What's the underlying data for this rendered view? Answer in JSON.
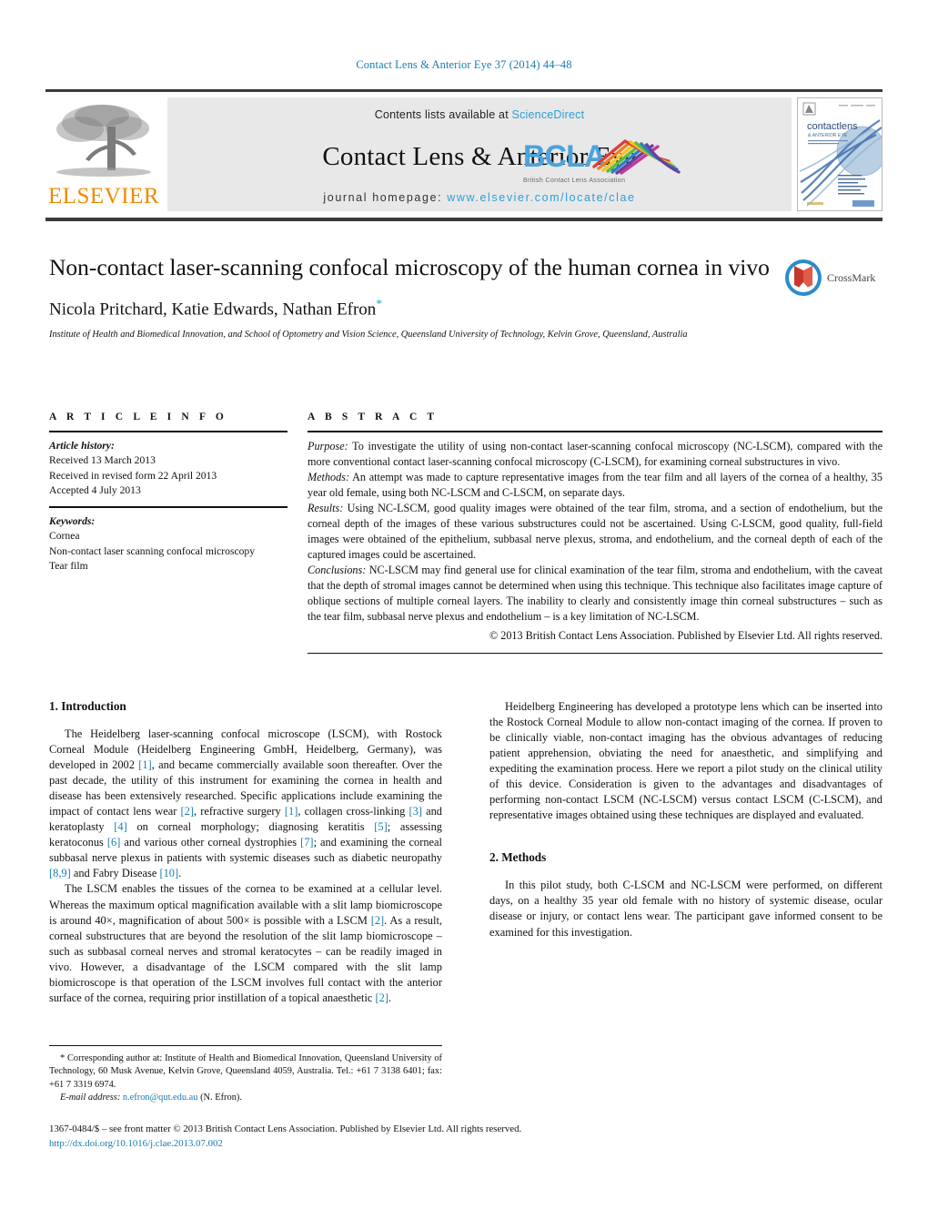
{
  "running_head": "Contact Lens & Anterior Eye 37 (2014) 44–48",
  "masthead": {
    "contents_prefix": "Contents lists available at ",
    "sciencedirect": "ScienceDirect",
    "journal_title": "Contact Lens & Anterior Eye",
    "homepage_prefix": "journal homepage: ",
    "homepage_url": "www.elsevier.com/locate/clae",
    "publisher_wordmark": "ELSEVIER",
    "society_acronym": "BCLA",
    "society_name": "British Contact Lens Association",
    "cover_title": "contactlens",
    "cover_subtitle": "& ANTERIOR EYE",
    "colors": {
      "link": "#2a9fd6",
      "elsevier_orange": "#f08a00",
      "panel_grey": "#e8e8e8",
      "rule_dark": "#3b3b3b",
      "bcla_blue": "#4aa3dd"
    }
  },
  "article": {
    "title": "Non-contact laser-scanning confocal microscopy of the human cornea in vivo",
    "authors": "Nicola Pritchard, Katie Edwards, Nathan Efron",
    "corresponding_marker": "*",
    "affiliation": "Institute of Health and Biomedical Innovation, and School of Optometry and Vision Science, Queensland University of Technology, Kelvin Grove, Queensland, Australia",
    "crossmark_label": "CrossMark"
  },
  "article_info": {
    "heading": "A R T I C L E   I N F O",
    "history_label": "Article history:",
    "history": [
      "Received 13 March 2013",
      "Received in revised form 22 April 2013",
      "Accepted 4 July 2013"
    ],
    "keywords_label": "Keywords:",
    "keywords": [
      "Cornea",
      "Non-contact laser scanning confocal microscopy",
      "Tear film"
    ]
  },
  "abstract": {
    "heading": "A B S T R A C T",
    "purpose_label": "Purpose:",
    "purpose_text": " To investigate the utility of using non-contact laser-scanning confocal microscopy (NC-LSCM), compared with the more conventional contact laser-scanning confocal microscopy (C-LSCM), for examining corneal substructures in vivo.",
    "methods_label": "Methods:",
    "methods_text": " An attempt was made to capture representative images from the tear film and all layers of the cornea of a healthy, 35 year old female, using both NC-LSCM and C-LSCM, on separate days.",
    "results_label": "Results:",
    "results_text": " Using NC-LSCM, good quality images were obtained of the tear film, stroma, and a section of endothelium, but the corneal depth of the images of these various substructures could not be ascertained. Using C-LSCM, good quality, full-field images were obtained of the epithelium, subbasal nerve plexus, stroma, and endothelium, and the corneal depth of each of the captured images could be ascertained.",
    "conclusions_label": "Conclusions:",
    "conclusions_text": " NC-LSCM may find general use for clinical examination of the tear film, stroma and endothelium, with the caveat that the depth of stromal images cannot be determined when using this technique. This technique also facilitates image capture of oblique sections of multiple corneal layers. The inability to clearly and consistently image thin corneal substructures – such as the tear film, subbasal nerve plexus and endothelium – is a key limitation of NC-LSCM.",
    "copyright": "© 2013 British Contact Lens Association. Published by Elsevier Ltd. All rights reserved."
  },
  "sections": {
    "intro_heading": "1.  Introduction",
    "intro_p1_a": "The Heidelberg laser-scanning confocal microscope (LSCM), with Rostock Corneal Module (Heidelberg Engineering GmbH, Heidelberg, Germany), was developed in 2002 ",
    "intro_p1_r1": "[1]",
    "intro_p1_b": ", and became commercially available soon thereafter. Over the past decade, the utility of this instrument for examining the cornea in health and disease has been extensively researched. Specific applications include examining the impact of contact lens wear ",
    "intro_p1_r2": "[2]",
    "intro_p1_c": ", refractive surgery ",
    "intro_p1_r3": "[1]",
    "intro_p1_d": ", collagen cross-linking ",
    "intro_p1_r4": "[3]",
    "intro_p1_e": " and keratoplasty ",
    "intro_p1_r5": "[4]",
    "intro_p1_f": " on corneal morphology; diagnosing keratitis ",
    "intro_p1_r6": "[5]",
    "intro_p1_g": "; assessing keratoconus ",
    "intro_p1_r7": "[6]",
    "intro_p1_h": " and various other corneal dystrophies ",
    "intro_p1_r8": "[7]",
    "intro_p1_i": "; and examining the corneal subbasal nerve plexus in patients with systemic diseases such as diabetic neuropathy ",
    "intro_p1_r9": "[8,9]",
    "intro_p1_j": " and Fabry Disease ",
    "intro_p1_r10": "[10]",
    "intro_p1_k": ".",
    "intro_p2_a": "The LSCM enables the tissues of the cornea to be examined at a cellular level. Whereas the maximum optical magnification available with a slit lamp biomicroscope is around 40×, magnification of about 500× is possible with a LSCM ",
    "intro_p2_r1": "[2]",
    "intro_p2_b": ". As a result, corneal substructures that are beyond the resolution of the slit lamp biomicroscope – such as subbasal corneal nerves and stromal keratocytes – can be readily imaged in vivo. However, a disadvantage of the LSCM compared with the slit lamp biomicroscope is that operation of the LSCM involves full contact with the anterior surface of the cornea, requiring prior instillation of a topical anaesthetic ",
    "intro_p2_r2": "[2]",
    "intro_p2_c": ".",
    "intro_p3": "Heidelberg Engineering has developed a prototype lens which can be inserted into the Rostock Corneal Module to allow non-contact imaging of the cornea. If proven to be clinically viable, non-contact imaging has the obvious advantages of reducing patient apprehension, obviating the need for anaesthetic, and simplifying and expediting the examination process. Here we report a pilot study on the clinical utility of this device. Consideration is given to the advantages and disadvantages of performing non-contact LSCM (NC-LSCM) versus contact LSCM (C-LSCM), and representative images obtained using these techniques are displayed and evaluated.",
    "methods_heading": "2.  Methods",
    "methods_p1": "In this pilot study, both C-LSCM and NC-LSCM were performed, on different days, on a healthy 35 year old female with no history of systemic disease, ocular disease or injury, or contact lens wear. The participant gave informed consent to be examined for this investigation."
  },
  "footnote": {
    "corresponding": "* Corresponding author at: Institute of Health and Biomedical Innovation, Queensland University of Technology, 60 Musk Avenue, Kelvin Grove, Queensland 4059, Australia. Tel.: +61 7 3138 6401; fax: +61 7 3319 6974.",
    "email_label": "E-mail address:",
    "email": "n.efron@qut.edu.au",
    "email_suffix": " (N. Efron).",
    "front_matter": "1367-0484/$ – see front matter © 2013 British Contact Lens Association. Published by Elsevier Ltd. All rights reserved.",
    "doi": "http://dx.doi.org/10.1016/j.clae.2013.07.002"
  }
}
